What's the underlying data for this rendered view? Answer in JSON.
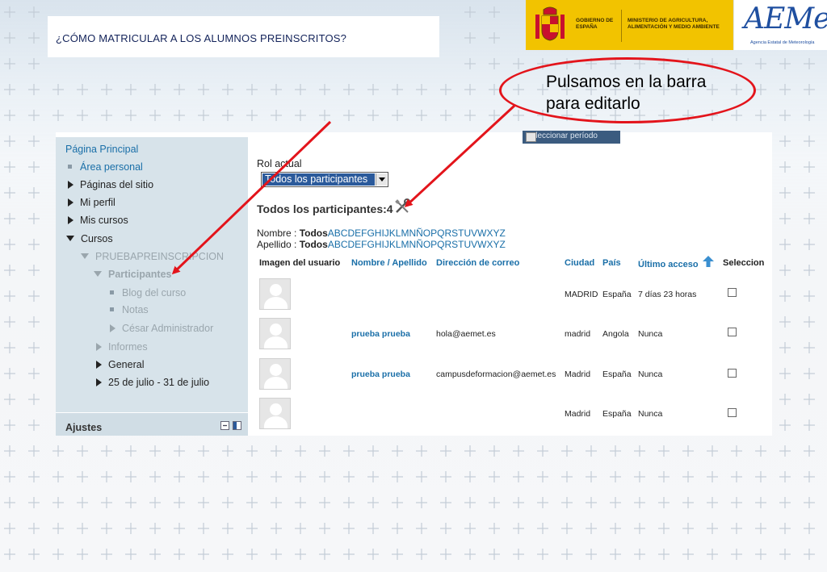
{
  "header": {
    "title": "¿CÓMO MATRICULAR A LOS ALUMNOS PREINSCRITOS?",
    "gov_label": "GOBIERNO DE ESPAÑA",
    "ministry_label": "MINISTERIO DE AGRICULTURA, ALIMENTACIÓN Y MEDIO AMBIENTE",
    "brand": "AEMet",
    "brand_sub": "Agencia Estatal de Meteorología"
  },
  "callout": {
    "line1": "Pulsamos en la barra",
    "line2": "para editarlo"
  },
  "sidebar": {
    "items": [
      {
        "label": "Página Principal"
      },
      {
        "label": "Área personal"
      },
      {
        "label": "Páginas del sitio"
      },
      {
        "label": "Mi perfil"
      },
      {
        "label": "Mis cursos"
      },
      {
        "label": "Cursos"
      },
      {
        "label": "PRUEBAPREINSCRIPCION"
      },
      {
        "label": "Participantes"
      },
      {
        "label": "Blog del curso"
      },
      {
        "label": "Notas"
      },
      {
        "label": "César Administrador"
      },
      {
        "label": "Informes"
      },
      {
        "label": "General"
      },
      {
        "label": "25 de julio - 31 de julio"
      }
    ],
    "settings_title": "Ajustes"
  },
  "main": {
    "period_button": "Seleccionar período",
    "role_label": "Rol actual",
    "role_value": "Todos los participantes",
    "participants_heading": "Todos los participantes:4",
    "filter_first_label": "Nombre : ",
    "filter_last_label": "Apellido : ",
    "filter_all": "Todos",
    "filter_letters": "ABCDEFGHIJKLMNÑOPQRSTUVWXYZ",
    "columns": {
      "image": "Imagen del usuario",
      "name": "Nombre / Apellido",
      "email": "Dirección de correo",
      "city": "Ciudad",
      "country": "País",
      "last_access": "Último acceso",
      "select": "Seleccion"
    },
    "rows": [
      {
        "name": "",
        "email": "",
        "city": "MADRID",
        "country": "España",
        "last_access": "7 días 23 horas"
      },
      {
        "name": "prueba prueba",
        "email": "hola@aemet.es",
        "city": "madrid",
        "country": "Angola",
        "last_access": "Nunca"
      },
      {
        "name": "prueba prueba",
        "email": "campusdeformacion@aemet.es",
        "city": "Madrid",
        "country": "España",
        "last_access": "Nunca"
      },
      {
        "name": "",
        "email": "",
        "city": "Madrid",
        "country": "España",
        "last_access": "Nunca"
      }
    ]
  },
  "colors": {
    "annotation": "#e3141b",
    "link": "#1a6fa8",
    "sidebar_bg": "#d7e3ea",
    "gov_yellow": "#f2c300"
  }
}
